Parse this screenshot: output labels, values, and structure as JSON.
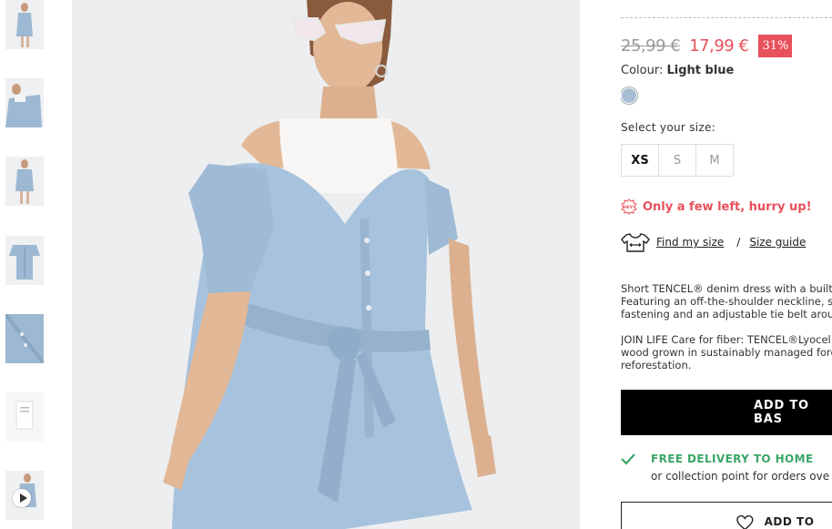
{
  "gallery": {
    "thumbnails": [
      "thumb-1",
      "thumb-2",
      "thumb-3",
      "thumb-4",
      "thumb-5",
      "thumb-6",
      "thumb-7-video"
    ]
  },
  "product": {
    "old_price": "25,99 €",
    "new_price": "17,99 €",
    "discount": "31%",
    "colour_label": "Colour:",
    "colour_value": "Light blue",
    "swatch_color": "#a7bdd3",
    "size_label": "Select your size:",
    "sizes": [
      "XS",
      "S",
      "M"
    ],
    "selected_size": "XS",
    "stock_badge": "HEY!",
    "stock_message": "Only a few left, hurry up!",
    "find_size": "Find my size",
    "size_separator": "/",
    "size_guide": "Size guide",
    "description": "Short TENCEL® denim dress with a built-\nFeaturing an off-the-shoulder neckline, s\nfastening and an adjustable tie belt arou",
    "care": "JOIN LIFE Care for fiber: TENCEL®Lyocel\nwood grown in sustainably managed fore\nreforestation.",
    "add_to_basket": "ADD TO BAS",
    "delivery_title": "FREE DELIVERY TO HOME",
    "delivery_sub": "or collection point for orders ove",
    "wishlist": "ADD TO WIS"
  },
  "colors": {
    "sale_red": "#e8505b",
    "delivery_green": "#3aa668",
    "button_black": "#000000"
  }
}
